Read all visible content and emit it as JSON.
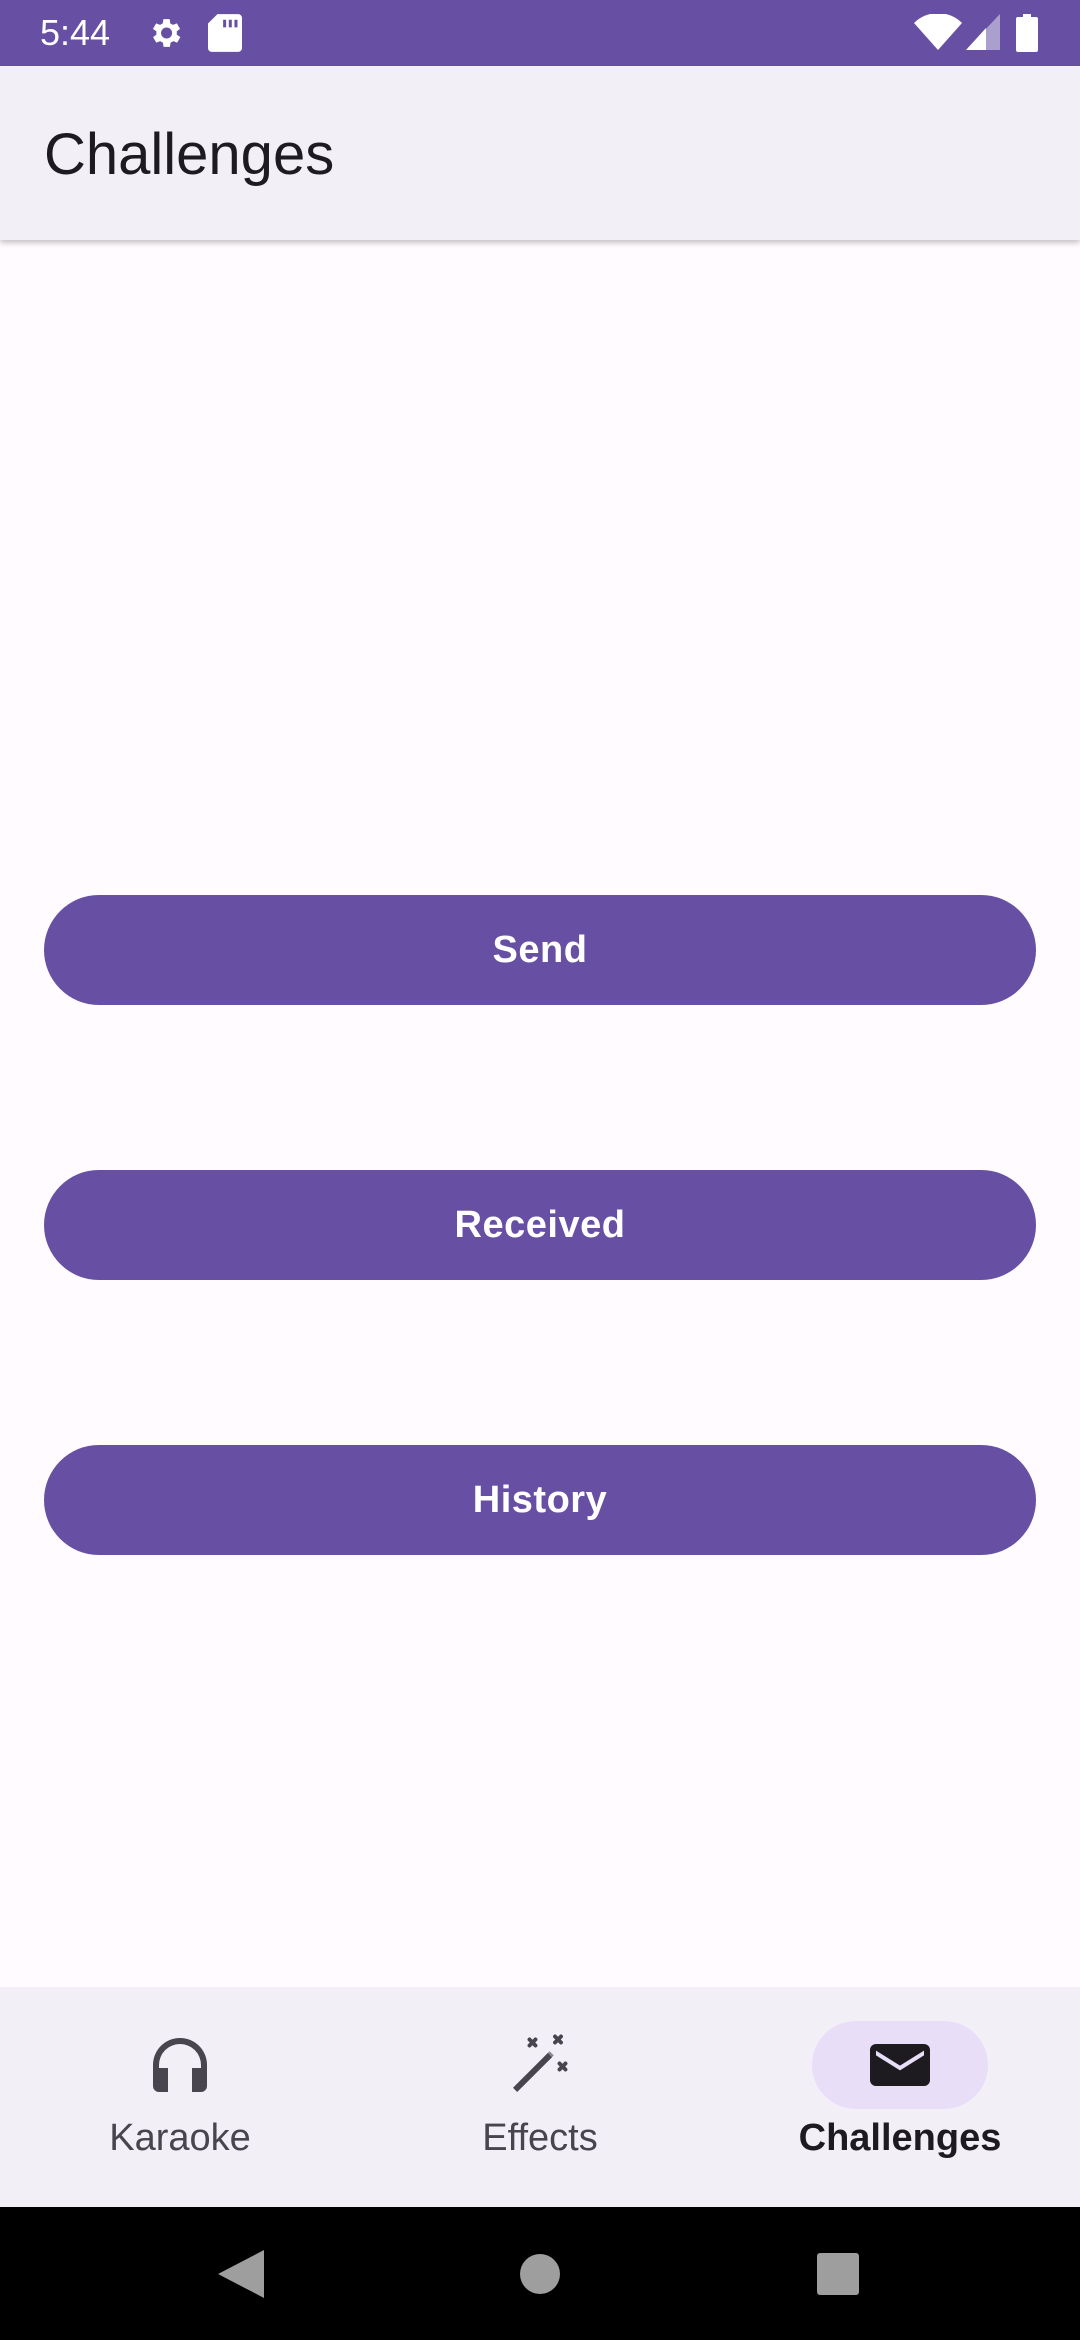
{
  "status_bar": {
    "time": "5:44",
    "icons": [
      "settings-icon",
      "sd-card-icon",
      "wifi-icon",
      "signal-icon",
      "battery-icon"
    ],
    "background": "#6750a4"
  },
  "app_bar": {
    "title": "Challenges"
  },
  "buttons": {
    "send": "Send",
    "received": "Received",
    "history": "History"
  },
  "bottom_nav": {
    "items": [
      {
        "label": "Karaoke",
        "icon": "headphones-icon",
        "active": false
      },
      {
        "label": "Effects",
        "icon": "magic-wand-icon",
        "active": false
      },
      {
        "label": "Challenges",
        "icon": "mail-icon",
        "active": true
      }
    ],
    "indicator_color": "#e8def8"
  },
  "system_nav": {
    "icons": [
      "back-icon",
      "home-icon",
      "recents-icon"
    ]
  },
  "colors": {
    "accent": "#6750a4",
    "surface": "#fffbfe",
    "surface_container": "#f3eff7"
  }
}
